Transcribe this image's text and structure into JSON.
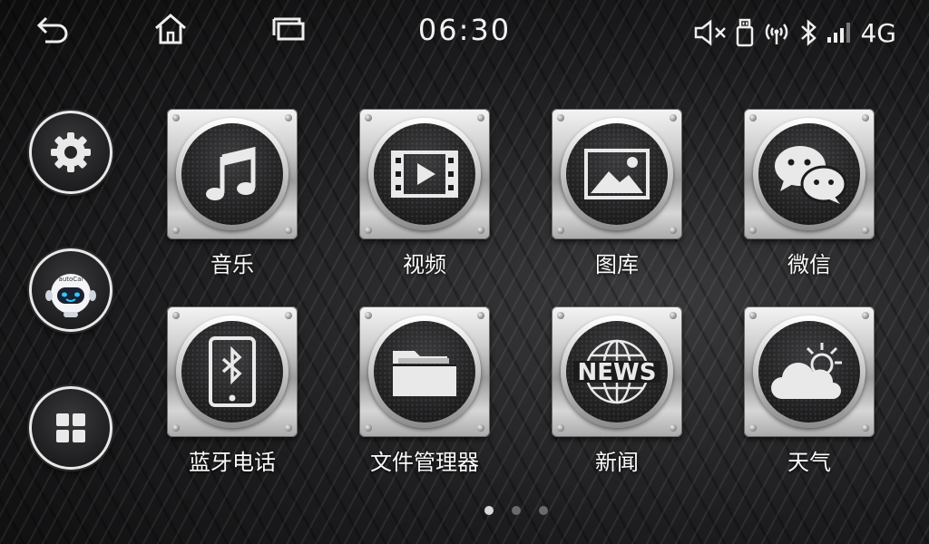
{
  "status_bar": {
    "time": "06:30",
    "network_label": "4G",
    "icons": [
      "back-icon",
      "home-icon",
      "recent-apps-icon",
      "volume-muted-icon",
      "usb-icon",
      "wifi-hotspot-icon",
      "bluetooth-icon",
      "signal-bars-icon"
    ]
  },
  "dock": {
    "items": [
      {
        "name": "settings",
        "icon": "gear-icon"
      },
      {
        "name": "voice-assistant",
        "icon": "robot-icon",
        "badge_text": "autoCai"
      },
      {
        "name": "all-apps",
        "icon": "app-grid-icon"
      }
    ]
  },
  "apps": [
    {
      "label": "音乐",
      "icon": "music-note-icon"
    },
    {
      "label": "视频",
      "icon": "video-play-icon"
    },
    {
      "label": "图库",
      "icon": "gallery-icon"
    },
    {
      "label": "微信",
      "icon": "wechat-icon"
    },
    {
      "label": "蓝牙电话",
      "icon": "bluetooth-phone-icon"
    },
    {
      "label": "文件管理器",
      "icon": "folder-icon"
    },
    {
      "label": "新闻",
      "icon": "news-globe-icon",
      "icon_text": "NEWS"
    },
    {
      "label": "天气",
      "icon": "weather-icon"
    }
  ],
  "pager": {
    "count": 3,
    "active": 0
  },
  "colors": {
    "accent": "#e8e8e8",
    "icon_fill": "#e9e9e9"
  }
}
